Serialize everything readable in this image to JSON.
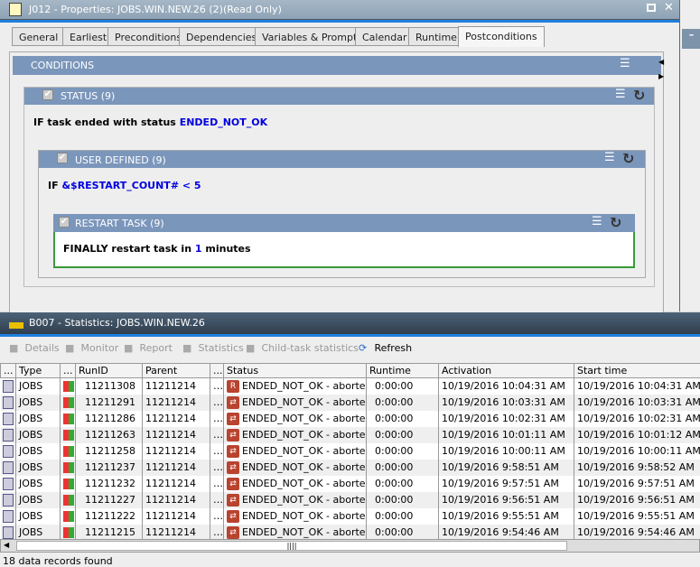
{
  "props_window": {
    "title": "J012 - Properties: JOBS.WIN.NEW.26 (2)(Read Only)",
    "tabs": [
      "General",
      "Earliest",
      "Preconditions",
      "Dependencies",
      "Variables & Prompts",
      "Calendar",
      "Runtime",
      "Postconditions"
    ],
    "active_tab": "Postconditions",
    "conditions_label": "CONDITIONS",
    "status_block": {
      "label": "STATUS (9)",
      "text": "IF task ended with status",
      "value": "ENDED_NOT_OK"
    },
    "user_block": {
      "label": "USER DEFINED (9)",
      "text": "IF",
      "value": "&$RESTART_COUNT# < 5"
    },
    "restart_block": {
      "label": "RESTART TASK (9)",
      "text_a": "FINALLY restart task in",
      "value": "1",
      "text_b": "minutes"
    }
  },
  "stats_window": {
    "title": "B007 - Statistics: JOBS.WIN.NEW.26",
    "toolbar": [
      "Details",
      "Monitor",
      "Report",
      "Statistics",
      "Child-task statistics",
      "Refresh"
    ],
    "columns": [
      "...",
      "Type",
      "...",
      "RunID",
      "Parent",
      "...",
      "Status",
      "Runtime",
      "Activation",
      "Start time"
    ],
    "rows": [
      [
        "JOBS",
        "11211308",
        "11211214",
        "ENDED_NOT_OK - aborted",
        "0:00:00",
        "10/19/2016 10:04:31 AM",
        "10/19/2016 10:04:31 AM"
      ],
      [
        "JOBS",
        "11211291",
        "11211214",
        "ENDED_NOT_OK - aborted",
        "0:00:00",
        "10/19/2016 10:03:31 AM",
        "10/19/2016 10:03:31 AM"
      ],
      [
        "JOBS",
        "11211286",
        "11211214",
        "ENDED_NOT_OK - aborted",
        "0:00:00",
        "10/19/2016 10:02:31 AM",
        "10/19/2016 10:02:31 AM"
      ],
      [
        "JOBS",
        "11211263",
        "11211214",
        "ENDED_NOT_OK - aborted",
        "0:00:00",
        "10/19/2016 10:01:11 AM",
        "10/19/2016 10:01:12 AM"
      ],
      [
        "JOBS",
        "11211258",
        "11211214",
        "ENDED_NOT_OK - aborted",
        "0:00:00",
        "10/19/2016 10:00:11 AM",
        "10/19/2016 10:00:11 AM"
      ],
      [
        "JOBS",
        "11211237",
        "11211214",
        "ENDED_NOT_OK - aborted",
        "0:00:00",
        "10/19/2016 9:58:51 AM",
        "10/19/2016 9:58:52 AM"
      ],
      [
        "JOBS",
        "11211232",
        "11211214",
        "ENDED_NOT_OK - aborted",
        "0:00:00",
        "10/19/2016 9:57:51 AM",
        "10/19/2016 9:57:51 AM"
      ],
      [
        "JOBS",
        "11211227",
        "11211214",
        "ENDED_NOT_OK - aborted",
        "0:00:00",
        "10/19/2016 9:56:51 AM",
        "10/19/2016 9:56:51 AM"
      ],
      [
        "JOBS",
        "11211222",
        "11211214",
        "ENDED_NOT_OK - aborted",
        "0:00:00",
        "10/19/2016 9:55:51 AM",
        "10/19/2016 9:55:51 AM"
      ],
      [
        "JOBS",
        "11211215",
        "11211214",
        "ENDED_NOT_OK - aborted",
        "0:00:00",
        "10/19/2016 9:54:46 AM",
        "10/19/2016 9:54:46 AM"
      ]
    ],
    "status_bar": "18 data records found"
  }
}
